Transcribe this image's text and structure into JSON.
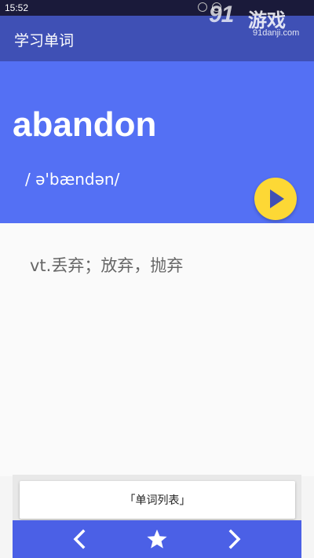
{
  "status_bar": {
    "time": "15:52"
  },
  "watermark": {
    "logo": "91",
    "cn": "游戏",
    "url": "91danji.com"
  },
  "app_bar": {
    "title": "学习单词"
  },
  "word": {
    "text": "abandon",
    "phonetic": "/ ə'bændən/",
    "meaning": "vt.丢弃；放弃，抛弃"
  },
  "actions": {
    "word_list_label": "「单词列表」"
  },
  "icons": {
    "play": "play-icon",
    "prev": "chevron-left-icon",
    "star": "star-icon",
    "next": "chevron-right-icon"
  },
  "colors": {
    "app_bar": "#3f50b5",
    "header": "#5470f4",
    "play_button": "#fdd835",
    "nav_bar": "#4b60e6"
  }
}
